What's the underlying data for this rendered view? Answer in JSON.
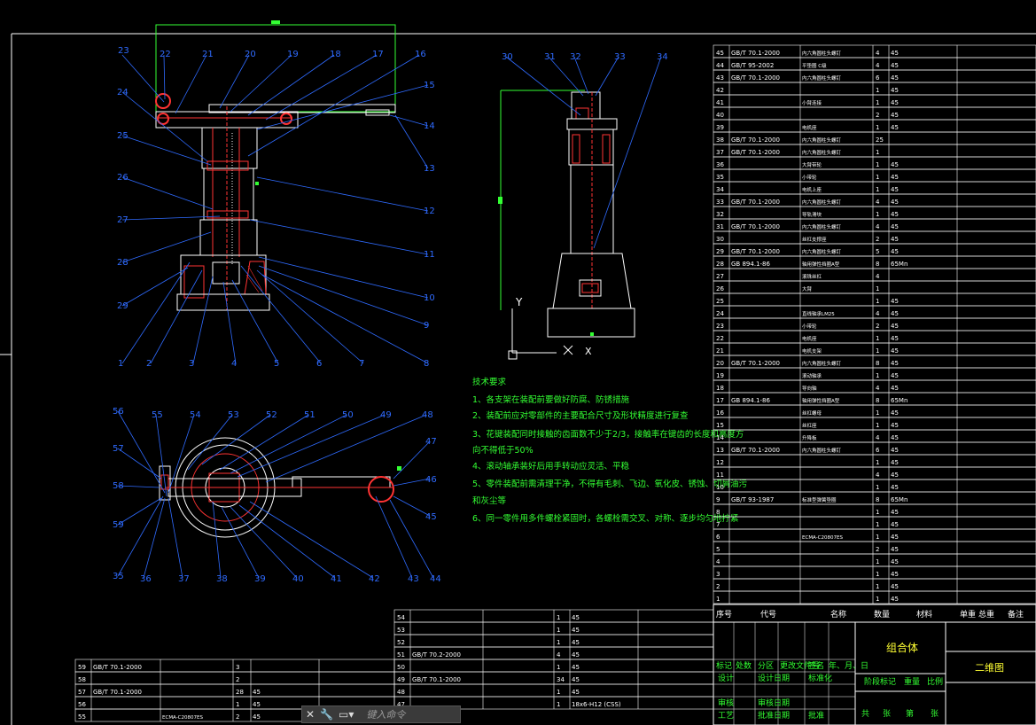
{
  "tech": {
    "title": "技术要求",
    "lines": [
      "1、各支架在装配前要做好防腐、防锈措施",
      "2、装配前应对零部件的主要配合尺寸及形状精度进行复查",
      "3、花键装配同时接触的齿面数不少于2/3，接触率在键齿的长度和高度方",
      "向不得低于50%",
      "4、滚动轴承装好后用手转动应灵活、平稳",
      "5、零件装配前需清理干净，不得有毛刺、飞边、氧化皮、锈蚀、切屑油污",
      "和灰尘等",
      "6、同一零件用多件螺栓紧固时，各螺栓需交叉、对称、逐步均匀地拧紧"
    ]
  },
  "axis": {
    "x": "X",
    "y": "Y"
  },
  "title_block": {
    "name": "组合体",
    "drawing": "二维图",
    "headers": {
      "seq": "序号",
      "code": "代号",
      "name": "名称",
      "qty": "数量",
      "mat": "材料",
      "unit": "单重",
      "total": "总重",
      "note": "备注"
    },
    "cells": [
      "标记",
      "处数",
      "分区",
      "更改文件号",
      "签名",
      "年、月、日",
      "设计",
      "设计日期",
      "标准化",
      "阶段标记",
      "重量",
      "比例",
      "审核",
      "审核日期",
      "工艺",
      "批准日期",
      "批准",
      "共",
      "张",
      "第",
      "张"
    ]
  },
  "views": {
    "front_labels": [
      "23",
      "22",
      "21",
      "20",
      "19",
      "18",
      "17",
      "16",
      "15",
      "14",
      "13",
      "12",
      "11",
      "10",
      "9",
      "8",
      "7",
      "6",
      "5",
      "4",
      "3",
      "2",
      "1",
      "29",
      "28",
      "27",
      "26",
      "25",
      "24"
    ],
    "side_labels": [
      "30",
      "31",
      "32",
      "33",
      "34"
    ],
    "top_labels": [
      "56",
      "55",
      "54",
      "53",
      "52",
      "51",
      "50",
      "49",
      "48",
      "47",
      "46",
      "45",
      "44",
      "43",
      "42",
      "41",
      "40",
      "39",
      "38",
      "37",
      "36",
      "35",
      "59",
      "58",
      "57"
    ]
  },
  "bom_right": [
    {
      "n": "45",
      "code": "GB/T 70.1-2000",
      "name": "内六角圆柱头螺钉",
      "qty": "4",
      "mat": "45"
    },
    {
      "n": "44",
      "code": "GB/T 95-2002",
      "name": "平垫圈 C级",
      "qty": "4",
      "mat": "45"
    },
    {
      "n": "43",
      "code": "GB/T 70.1-2000",
      "name": "内六角圆柱头螺钉",
      "qty": "6",
      "mat": "45"
    },
    {
      "n": "42",
      "code": "",
      "name": "",
      "qty": "1",
      "mat": "45"
    },
    {
      "n": "41",
      "code": "",
      "name": "小臂连接",
      "qty": "1",
      "mat": "45"
    },
    {
      "n": "40",
      "code": "",
      "name": "",
      "qty": "2",
      "mat": "45"
    },
    {
      "n": "39",
      "code": "",
      "name": "电机座",
      "qty": "1",
      "mat": "45"
    },
    {
      "n": "38",
      "code": "GB/T 70.1-2000",
      "name": "内六角圆柱头螺钉",
      "qty": "25",
      "mat": ""
    },
    {
      "n": "37",
      "code": "GB/T 70.1-2000",
      "name": "内六角圆柱头螺钉",
      "qty": "1",
      "mat": ""
    },
    {
      "n": "36",
      "code": "",
      "name": "大臂带轮",
      "qty": "1",
      "mat": "45"
    },
    {
      "n": "35",
      "code": "",
      "name": "小带轮",
      "qty": "1",
      "mat": "45"
    },
    {
      "n": "34",
      "code": "",
      "name": "电机上座",
      "qty": "1",
      "mat": "45"
    },
    {
      "n": "33",
      "code": "GB/T 70.1-2000",
      "name": "内六角圆柱头螺钉",
      "qty": "4",
      "mat": "45"
    },
    {
      "n": "32",
      "code": "",
      "name": "导轨滑块",
      "qty": "1",
      "mat": "45"
    },
    {
      "n": "31",
      "code": "GB/T 70.1-2000",
      "name": "内六角圆柱头螺钉",
      "qty": "4",
      "mat": "45"
    },
    {
      "n": "30",
      "code": "",
      "name": "丝杠支撑座",
      "qty": "2",
      "mat": "45"
    },
    {
      "n": "29",
      "code": "GB/T 70.1-2000",
      "name": "内六角圆柱头螺钉",
      "qty": "5",
      "mat": "45"
    },
    {
      "n": "28",
      "code": "GB 894.1-86",
      "name": "轴用弹性挡圈A型",
      "qty": "8",
      "mat": "65Mn"
    },
    {
      "n": "27",
      "code": "",
      "name": "滚珠丝杠",
      "qty": "4",
      "mat": ""
    },
    {
      "n": "26",
      "code": "",
      "name": "大臂",
      "qty": "1",
      "mat": ""
    },
    {
      "n": "25",
      "code": "",
      "name": "",
      "qty": "1",
      "mat": "45"
    },
    {
      "n": "24",
      "code": "",
      "name": "直线轴承LM25",
      "qty": "4",
      "mat": "45"
    },
    {
      "n": "23",
      "code": "",
      "name": "小带轮",
      "qty": "2",
      "mat": "45"
    },
    {
      "n": "22",
      "code": "",
      "name": "电机座",
      "qty": "1",
      "mat": "45"
    },
    {
      "n": "21",
      "code": "",
      "name": "电机支架",
      "qty": "1",
      "mat": "45"
    },
    {
      "n": "20",
      "code": "GB/T 70.1-2000",
      "name": "内六角圆柱头螺钉",
      "qty": "8",
      "mat": "45"
    },
    {
      "n": "19",
      "code": "",
      "name": "滚动轴承",
      "qty": "1",
      "mat": "45"
    },
    {
      "n": "18",
      "code": "",
      "name": "导向轴",
      "qty": "4",
      "mat": "45"
    },
    {
      "n": "17",
      "code": "GB 894.1-86",
      "name": "轴用弹性挡圈A型",
      "qty": "8",
      "mat": "65Mn"
    },
    {
      "n": "16",
      "code": "",
      "name": "丝杠螺母",
      "qty": "1",
      "mat": "45"
    },
    {
      "n": "15",
      "code": "",
      "name": "丝杠座",
      "qty": "1",
      "mat": "45"
    },
    {
      "n": "14",
      "code": "",
      "name": "升降板",
      "qty": "4",
      "mat": "45"
    },
    {
      "n": "13",
      "code": "GB/T 70.1-2000",
      "name": "内六角圆柱头螺钉",
      "qty": "6",
      "mat": "45"
    },
    {
      "n": "12",
      "code": "",
      "name": "",
      "qty": "1",
      "mat": "45"
    },
    {
      "n": "11",
      "code": "",
      "name": "",
      "qty": "4",
      "mat": "45"
    },
    {
      "n": "10",
      "code": "",
      "name": "",
      "qty": "1",
      "mat": "45"
    },
    {
      "n": "9",
      "code": "GB/T 93-1987",
      "name": "标准型弹簧垫圈",
      "qty": "8",
      "mat": "65Mn"
    },
    {
      "n": "8",
      "code": "",
      "name": "",
      "qty": "1",
      "mat": "45"
    },
    {
      "n": "7",
      "code": "",
      "name": "",
      "qty": "1",
      "mat": "45"
    },
    {
      "n": "6",
      "code": "",
      "name": "ECMA-C20807ES",
      "qty": "1",
      "mat": "45"
    },
    {
      "n": "5",
      "code": "",
      "name": "",
      "qty": "2",
      "mat": "45"
    },
    {
      "n": "4",
      "code": "",
      "name": "",
      "qty": "1",
      "mat": "45"
    },
    {
      "n": "3",
      "code": "",
      "name": "",
      "qty": "1",
      "mat": "45"
    },
    {
      "n": "2",
      "code": "",
      "name": "",
      "qty": "1",
      "mat": "45"
    },
    {
      "n": "1",
      "code": "",
      "name": "",
      "qty": "1",
      "mat": "45"
    }
  ],
  "bom_mid": [
    {
      "n": "54",
      "code": "",
      "name": "",
      "qty": "1",
      "mat": "45"
    },
    {
      "n": "53",
      "code": "",
      "name": "",
      "qty": "1",
      "mat": "45"
    },
    {
      "n": "52",
      "code": "",
      "name": "",
      "qty": "1",
      "mat": "45"
    },
    {
      "n": "51",
      "code": "GB/T 70.2-2000",
      "name": "",
      "qty": "4",
      "mat": "45"
    },
    {
      "n": "50",
      "code": "",
      "name": "",
      "qty": "1",
      "mat": "45"
    },
    {
      "n": "49",
      "code": "GB/T 70.1-2000",
      "name": "",
      "qty": "34",
      "mat": "45"
    },
    {
      "n": "48",
      "code": "",
      "name": "",
      "qty": "1",
      "mat": "45"
    },
    {
      "n": "47",
      "code": "",
      "name": "",
      "qty": "1",
      "mat": "18x6-H12 (CSS)"
    }
  ],
  "bom_left": [
    {
      "n": "59",
      "code": "GB/T 70.1-2000",
      "name": "",
      "qty": "3",
      "mat": ""
    },
    {
      "n": "58",
      "code": "",
      "name": "",
      "qty": "2",
      "mat": ""
    },
    {
      "n": "57",
      "code": "GB/T 70.1-2000",
      "name": "",
      "qty": "28",
      "mat": "45"
    },
    {
      "n": "56",
      "code": "",
      "name": "",
      "qty": "1",
      "mat": "45"
    },
    {
      "n": "55",
      "code": "",
      "name": "ECMA-C20807ES",
      "qty": "2",
      "mat": "45"
    }
  ],
  "cmd": {
    "placeholder": "键入命令"
  }
}
